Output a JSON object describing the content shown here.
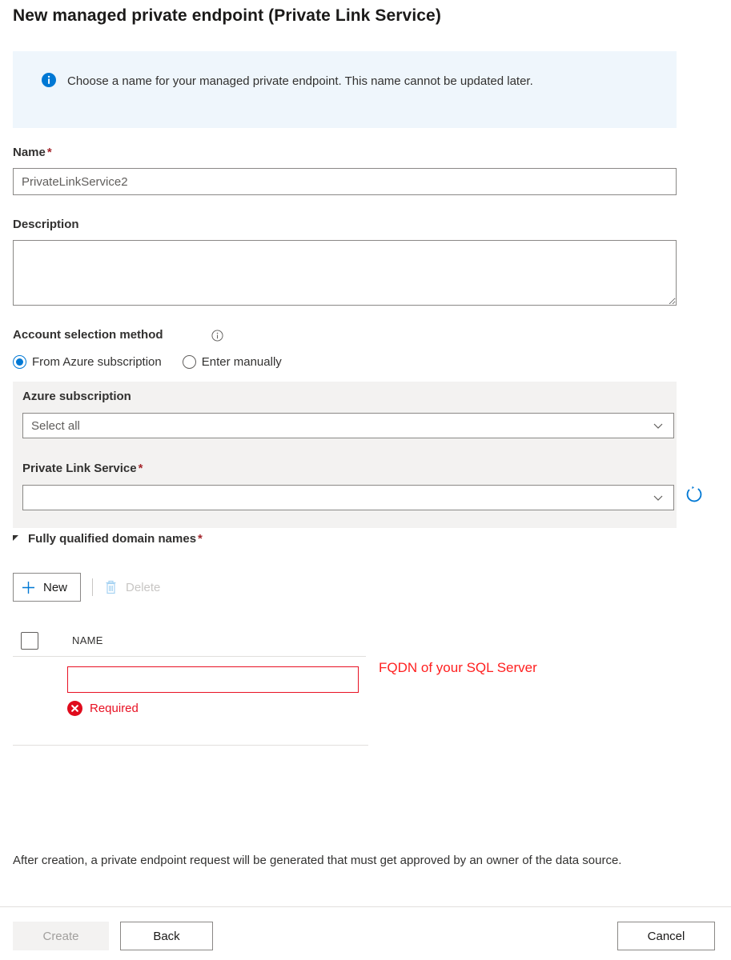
{
  "title": "New managed private endpoint (Private Link Service)",
  "info_banner": {
    "icon": "info-circle-icon",
    "text": "Choose a name for your managed private endpoint. This name cannot be updated later."
  },
  "form": {
    "name": {
      "label": "Name",
      "required_mark": "*",
      "value": "PrivateLinkService2",
      "placeholder": "PrivateLinkService2"
    },
    "description": {
      "label": "Description",
      "value": "",
      "placeholder": ""
    },
    "account_selection": {
      "label": "Account selection method",
      "info_icon": "info-outline-icon",
      "options": [
        {
          "label": "From Azure subscription",
          "selected": true
        },
        {
          "label": "Enter manually",
          "selected": false
        }
      ]
    },
    "azure_subscription": {
      "label": "Azure subscription",
      "value": "Select all",
      "chevron_icon": "chevron-down-icon"
    },
    "private_link_service": {
      "label": "Private Link Service",
      "required_mark": "*",
      "value": "",
      "chevron_icon": "chevron-down-icon",
      "refresh_icon": "refresh-icon"
    }
  },
  "fqdn_section": {
    "title": "Fully qualified domain names",
    "required_mark": "*",
    "expander_icon": "triangle-expanded-icon",
    "toolbar": {
      "new_label": "New",
      "new_icon": "plus-icon",
      "delete_label": "Delete",
      "delete_icon": "trash-icon",
      "delete_disabled": true
    },
    "table": {
      "columns": [
        "NAME"
      ],
      "rows": [
        {
          "value": "",
          "error": "Required",
          "error_icon": "error-circle-x-icon"
        }
      ]
    },
    "annotation": "FQDN of your SQL Server"
  },
  "footer_note": "After creation, a private endpoint request will be generated that must get approved by an owner of the data source.",
  "actions": {
    "create_label": "Create",
    "back_label": "Back",
    "cancel_label": "Cancel"
  },
  "colors": {
    "accent": "#0078d4",
    "info_bg": "#eff6fc",
    "panel_bg": "#f3f2f1",
    "error_red": "#e81123",
    "annotation_red": "#ff2020",
    "required_star": "#a4262c"
  }
}
